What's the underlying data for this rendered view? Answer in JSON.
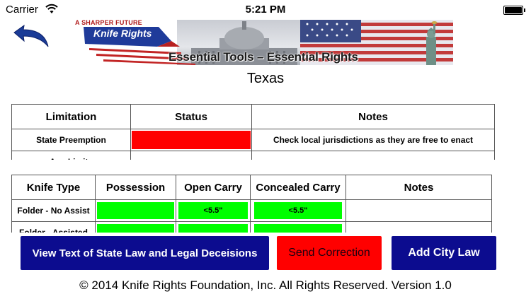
{
  "status_bar": {
    "carrier": "Carrier",
    "time": "5:21 PM"
  },
  "banner": {
    "tag": "A SHARPER FUTURE",
    "brand": "Knife Rights",
    "tagline": "Essential Tools – Essential Rights"
  },
  "state": "Texas",
  "limitations_table": {
    "headers": [
      "Limitation",
      "Status",
      "Notes"
    ],
    "rows": [
      {
        "limitation": "State Preemption",
        "status_color": "#ff0000",
        "notes": "Check local jurisdictions as they are free to enact"
      },
      {
        "limitation": "Age Limits",
        "status_color": "",
        "notes": ""
      }
    ]
  },
  "knife_table": {
    "headers": [
      "Knife Type",
      "Possession",
      "Open Carry",
      "Concealed Carry",
      "Notes"
    ],
    "rows": [
      {
        "type": "Folder - No Assist",
        "possession": "",
        "open_carry": "<5.5\"",
        "concealed_carry": "<5.5\"",
        "notes": ""
      },
      {
        "type": "Folder - Assisted",
        "possession": "",
        "open_carry": "",
        "concealed_carry": "",
        "notes": ""
      }
    ]
  },
  "buttons": {
    "view_law": "View Text of State Law and Legal Deceisions",
    "send_correction": "Send Correction",
    "add_city_law": "Add City Law"
  },
  "footer": "© 2014 Knife Rights Foundation, Inc. All Rights Reserved. Version 1.0",
  "colors": {
    "button_blue": "#0c0c8f",
    "status_red": "#ff0000",
    "status_green": "#00ff00"
  },
  "icons": [
    "wifi-icon",
    "battery-icon",
    "back-arrow-icon"
  ]
}
